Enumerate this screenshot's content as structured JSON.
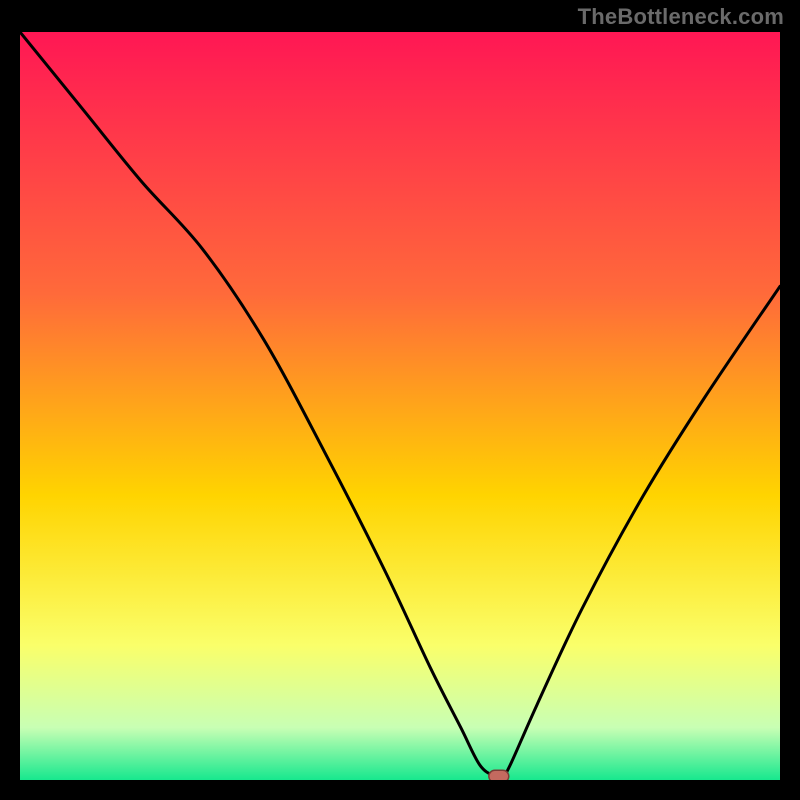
{
  "watermark": "TheBottleneck.com",
  "chart_data": {
    "type": "line",
    "title": "",
    "xlabel": "",
    "ylabel": "",
    "xlim": [
      0,
      100
    ],
    "ylim": [
      0,
      100
    ],
    "grid": false,
    "legend": false,
    "series": [
      {
        "name": "curve",
        "x": [
          0,
          8,
          16,
          24,
          32,
          40,
          48,
          54,
          58,
          60.5,
          62.5,
          63.5,
          64.5,
          68,
          74,
          82,
          90,
          100
        ],
        "values": [
          100,
          90,
          80,
          71,
          59,
          44,
          28,
          15,
          7,
          2,
          0.5,
          0.5,
          2,
          10,
          23,
          38,
          51,
          66
        ]
      }
    ],
    "marker": {
      "x": 63,
      "y": 0.5
    }
  },
  "colors": {
    "gradient_top": "#ff1754",
    "gradient_mid1": "#ff6a3a",
    "gradient_mid2": "#ffd400",
    "gradient_mid3": "#faff6a",
    "gradient_mid4": "#c8ffb4",
    "gradient_bottom": "#17e88e",
    "curve": "#000000",
    "marker_fill": "#c46a5f",
    "marker_stroke": "#7a3d36"
  }
}
